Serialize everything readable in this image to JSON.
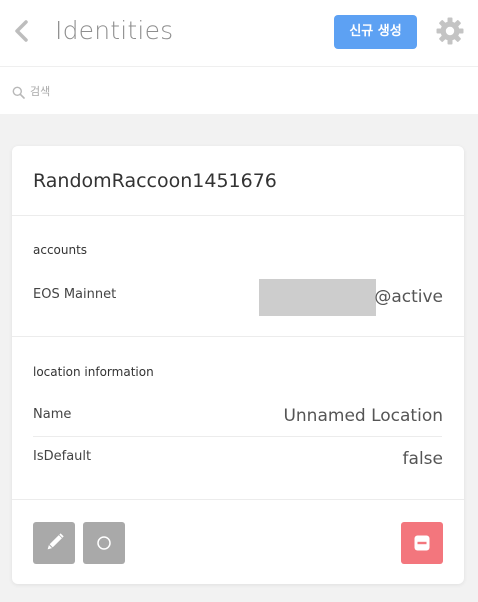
{
  "header": {
    "title": "Identities",
    "new_button_label": "신규 생성",
    "accent_color": "#5da1f3"
  },
  "search": {
    "placeholder": "검색",
    "value": ""
  },
  "identity": {
    "name": "RandomRaccoon1451676",
    "accounts_label": "accounts",
    "accounts": [
      {
        "network": "EOS Mainnet",
        "account": "@active",
        "account_name_redacted": true
      }
    ],
    "location_label": "location information",
    "location": {
      "name_label": "Name",
      "name_value": "Unnamed Location",
      "isdefault_label": "IsDefault",
      "isdefault_value": "false"
    }
  },
  "actions": {
    "edit_icon": "pencil-icon",
    "select_icon": "circle-icon",
    "remove_icon": "minus-icon",
    "remove_color": "#f3767d"
  }
}
